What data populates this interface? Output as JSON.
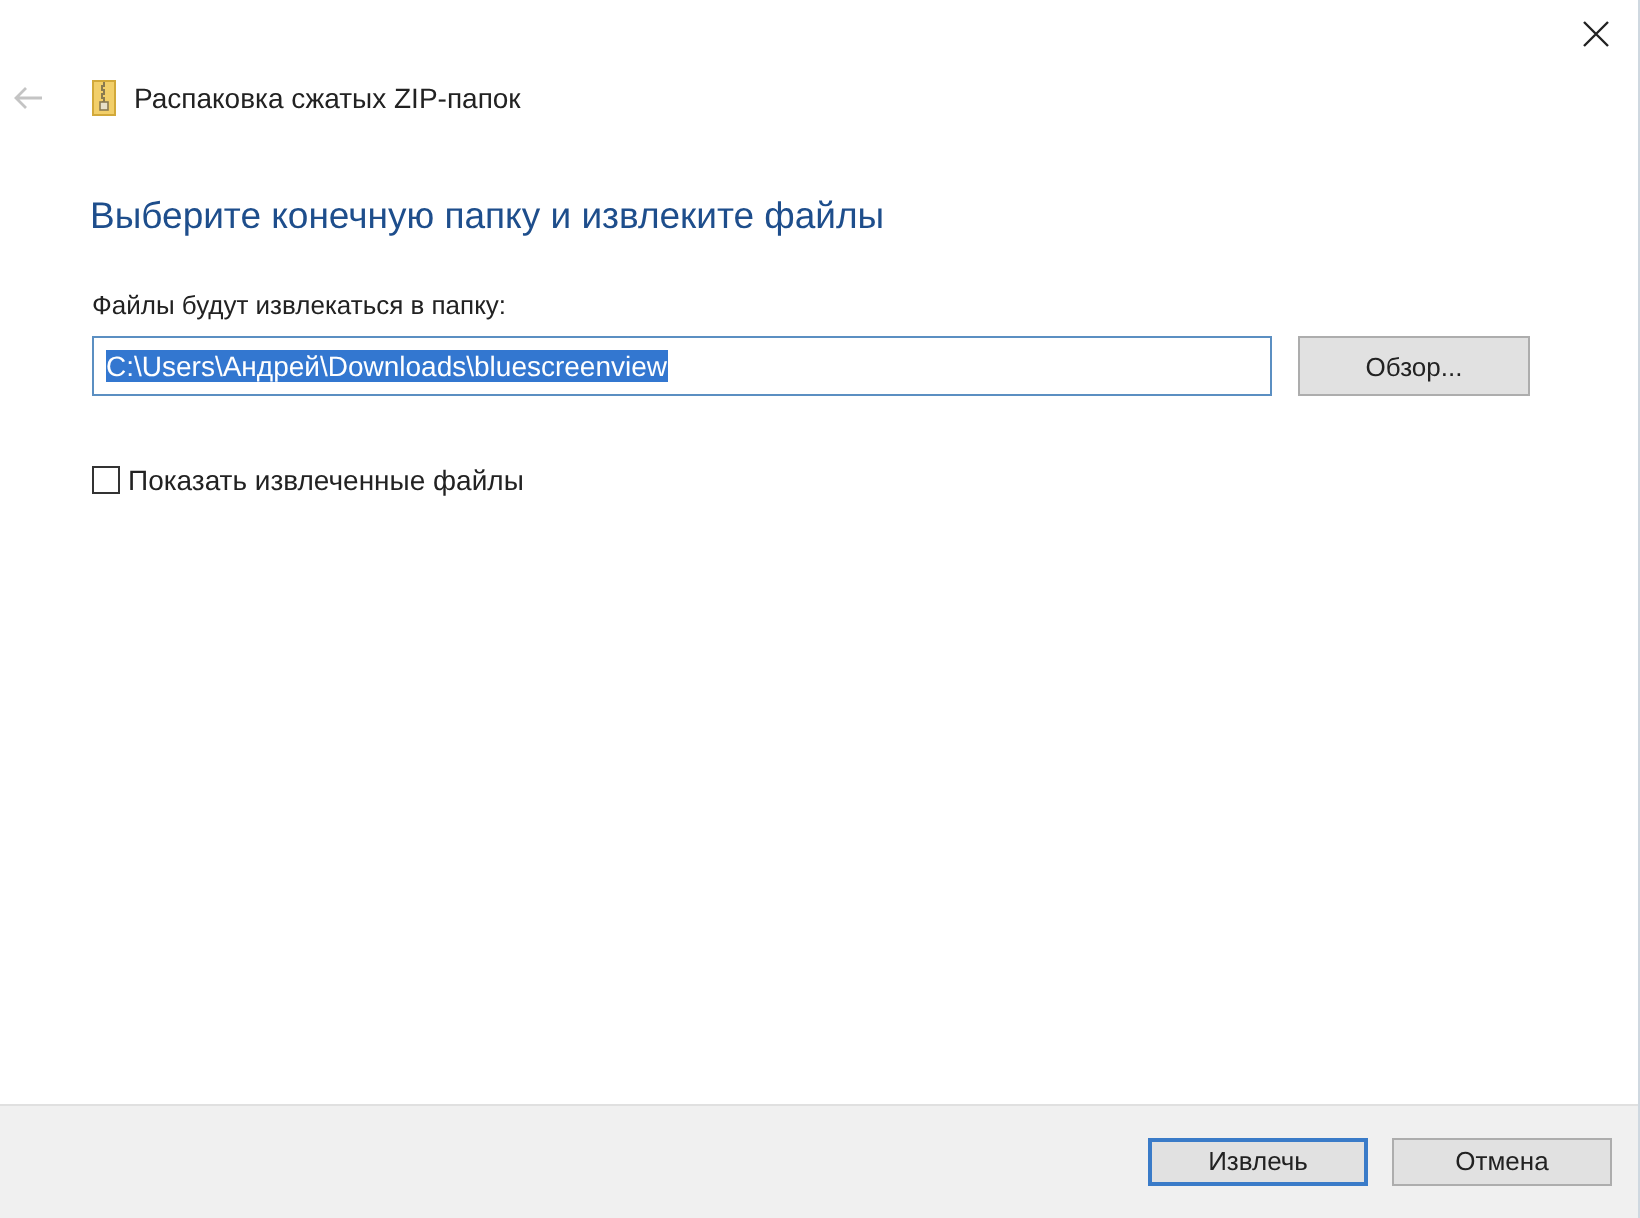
{
  "window": {
    "title": "Распаковка сжатых ZIP-папок",
    "back_disabled": true
  },
  "heading": "Выберите конечную папку и извлеките файлы",
  "destination": {
    "label": "Файлы будут извлекаться в папку:",
    "value": "C:\\Users\\Андрей\\Downloads\\bluescreenview",
    "value_selected": true,
    "browse_button": "Обзор..."
  },
  "show_files": {
    "label": "Показать извлеченные файлы",
    "checked": false
  },
  "buttons": [
    {
      "label": "Извлечь",
      "default": true
    },
    {
      "label": "Отмена",
      "default": false
    }
  ]
}
